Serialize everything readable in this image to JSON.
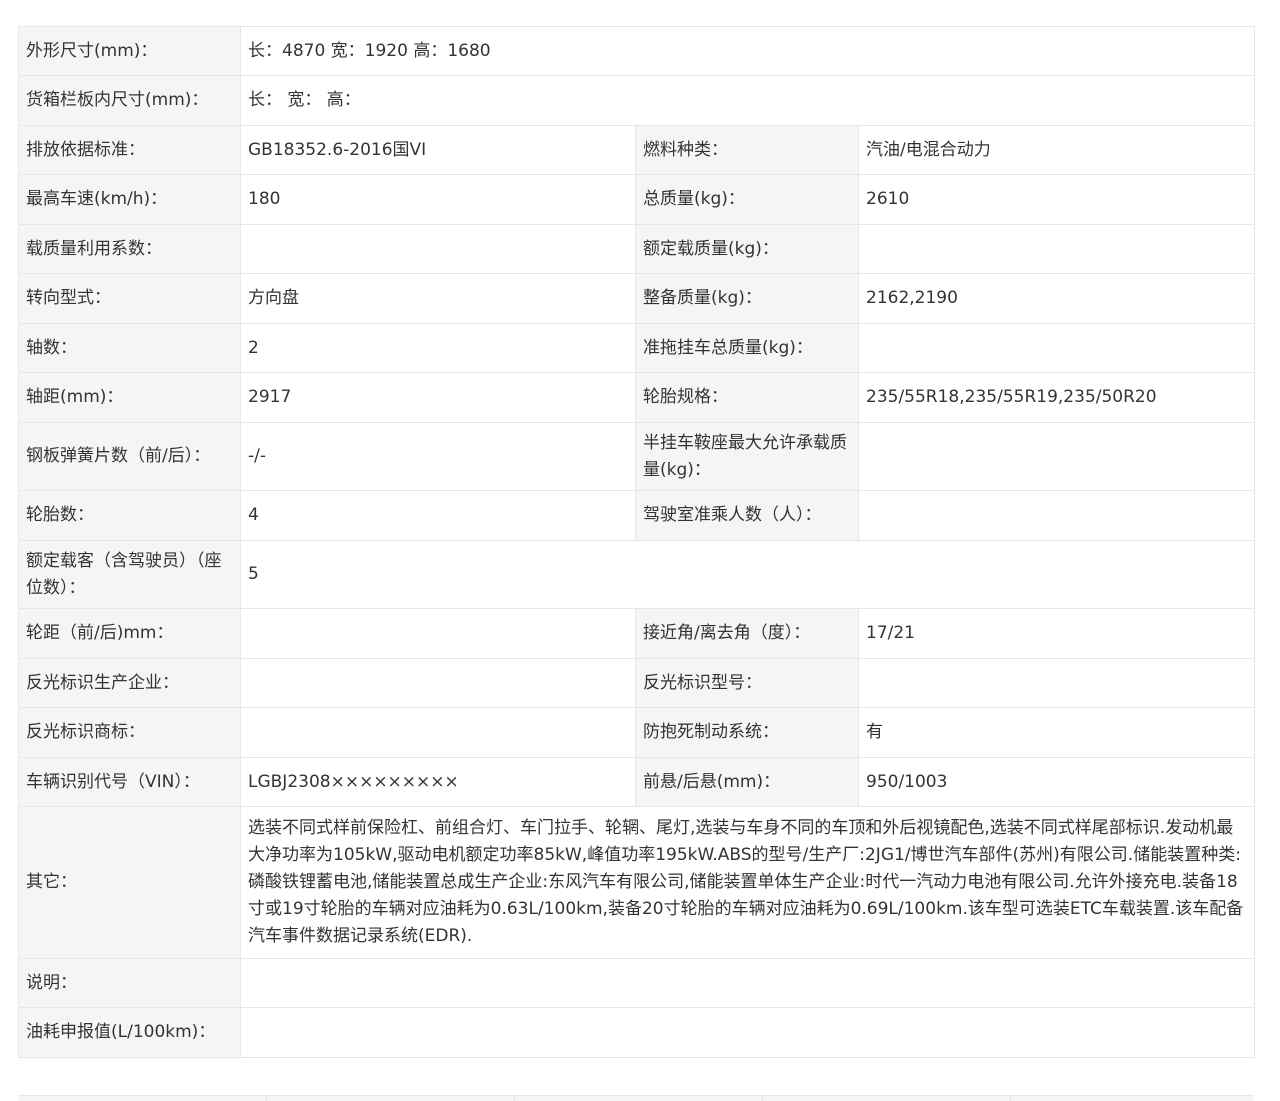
{
  "rows": [
    {
      "type": "full",
      "label": "外形尺寸(mm)：",
      "value": "长：4870 宽：1920 高：1680"
    },
    {
      "type": "full",
      "label": "货箱栏板内尺寸(mm)：",
      "value": "长： 宽： 高："
    },
    {
      "type": "pair",
      "label1": "排放依据标准：",
      "value1": "GB18352.6-2016国VI",
      "label2": "燃料种类：",
      "value2": "汽油/电混合动力"
    },
    {
      "type": "pair",
      "label1": "最高车速(km/h)：",
      "value1": "180",
      "label2": "总质量(kg)：",
      "value2": "2610"
    },
    {
      "type": "pair",
      "label1": "载质量利用系数：",
      "value1": "",
      "label2": "额定载质量(kg)：",
      "value2": ""
    },
    {
      "type": "pair",
      "label1": "转向型式：",
      "value1": "方向盘",
      "label2": "整备质量(kg)：",
      "value2": "2162,2190"
    },
    {
      "type": "pair",
      "label1": "轴数：",
      "value1": "2",
      "label2": "准拖挂车总质量(kg)：",
      "value2": ""
    },
    {
      "type": "pair",
      "label1": "轴距(mm)：",
      "value1": "2917",
      "label2": "轮胎规格：",
      "value2": "235/55R18,235/55R19,235/50R20"
    },
    {
      "type": "pair",
      "label1": "钢板弹簧片数（前/后）：",
      "value1": "-/-",
      "label2": "半挂车鞍座最大允许承载质量(kg)：",
      "value2": ""
    },
    {
      "type": "pair",
      "label1": "轮胎数：",
      "value1": "4",
      "label2": "驾驶室准乘人数（人）：",
      "value2": ""
    },
    {
      "type": "full",
      "label": "额定载客（含驾驶员）（座位数）：",
      "value": "5"
    },
    {
      "type": "pair",
      "label1": "轮距（前/后)mm：",
      "value1": "",
      "label2": "接近角/离去角（度）：",
      "value2": "17/21"
    },
    {
      "type": "pair",
      "label1": "反光标识生产企业：",
      "value1": "",
      "label2": "反光标识型号：",
      "value2": ""
    },
    {
      "type": "pair",
      "label1": "反光标识商标：",
      "value1": "",
      "label2": "防抱死制动系统：",
      "value2": "有"
    },
    {
      "type": "pair",
      "label1": "车辆识别代号（VIN）：",
      "value1": "LGBJ2308×××××××××",
      "label2": "前悬/后悬(mm)：",
      "value2": "950/1003"
    },
    {
      "type": "full",
      "label": "其它：",
      "value": "选装不同式样前保险杠、前组合灯、车门拉手、轮辋、尾灯,选装与车身不同的车顶和外后视镜配色,选装不同式样尾部标识.发动机最大净功率为105kW,驱动电机额定功率85kW,峰值功率195kW.ABS的型号/生产厂:2JG1/博世汽车部件(苏州)有限公司.储能装置种类:磷酸铁锂蓄电池,储能装置总成生产企业:东风汽车有限公司,储能装置单体生产企业:时代一汽动力电池有限公司.允许外接充电.装备18寸或19寸轮胎的车辆对应油耗为0.63L/100km,装备20寸轮胎的车辆对应油耗为0.69L/100km.该车型可选装ETC车载装置.该车配备汽车事件数据记录系统(EDR)."
    },
    {
      "type": "full",
      "label": "说明：",
      "value": ""
    },
    {
      "type": "full",
      "label": "油耗申报值(L/100km)：",
      "value": ""
    }
  ]
}
